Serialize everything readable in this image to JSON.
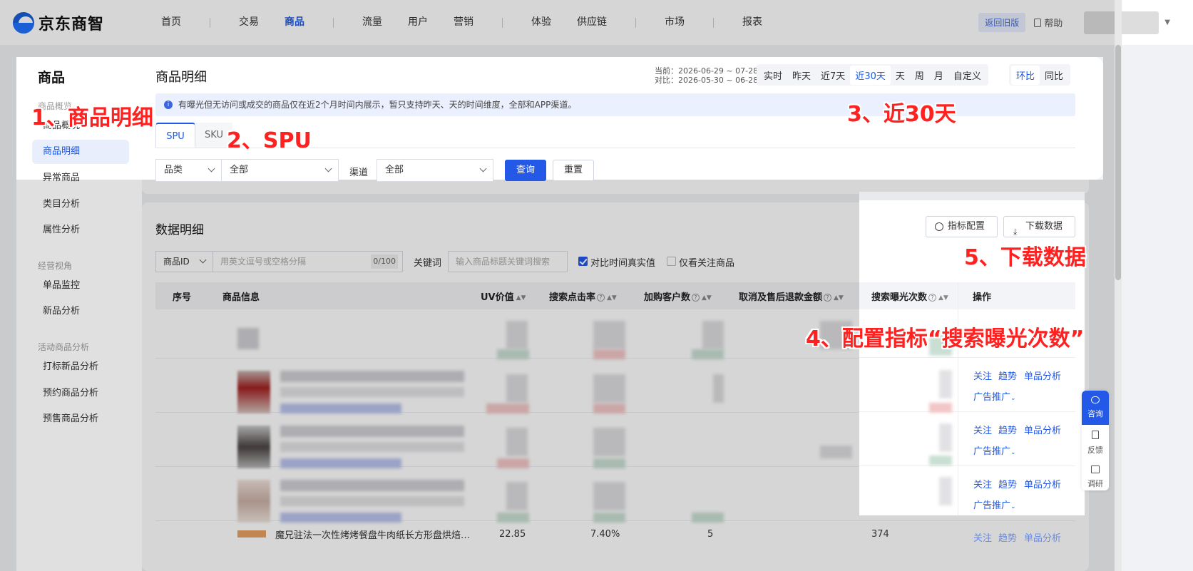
{
  "brand": {
    "name": "京东商智"
  },
  "nav": {
    "items": [
      "首页",
      "交易",
      "商品",
      "流量",
      "用户",
      "营销",
      "体验",
      "供应链",
      "市场",
      "报表"
    ],
    "active": "商品"
  },
  "top_right": {
    "old_version": "返回旧版",
    "help": "帮助"
  },
  "sidebar": {
    "title": "商品",
    "group1": "商品概览",
    "item_overview": "商品概况",
    "item_detail": "商品明细",
    "item_abnormal": "异常商品",
    "item_category": "类目分析",
    "item_attr": "属性分析",
    "group2": "经营视角",
    "item_single": "单品监控",
    "item_new": "新品分析",
    "group3": "活动商品分析",
    "item_tag_new": "打标新品分析",
    "item_presale_order": "预约商品分析",
    "item_presale": "预售商品分析"
  },
  "header": {
    "title": "商品明细",
    "current_range": "当前：2026-06-29 ~ 07-28",
    "compare_range": "对比：2026-05-30 ~ 06-28",
    "time_tabs": [
      "实时",
      "昨天",
      "近7天",
      "近30天",
      "天",
      "周",
      "月",
      "自定义"
    ],
    "time_active": "近30天",
    "compare_tabs": [
      "环比",
      "同比"
    ],
    "compare_active": "环比"
  },
  "notice": "有曝光但无访问或成交的商品仅在近2个月时间内展示，暂只支持昨天、天的时间维度，全部和APP渠道。",
  "tabs": {
    "spu": "SPU",
    "sku": "SKU"
  },
  "filters": {
    "category_label": "品类",
    "category_value": "全部",
    "channel_label": "渠道",
    "channel_value": "全部",
    "query": "查询",
    "reset": "重置"
  },
  "data_section": {
    "title": "数据明细",
    "id_select": "商品ID",
    "id_placeholder": "用英文逗号或空格分隔",
    "id_count": "0/100",
    "keyword_label": "关键词",
    "keyword_placeholder": "输入商品标题关键词搜索",
    "check_compare": "对比时间真实值",
    "check_compare_checked": true,
    "check_follow": "仅看关注商品",
    "check_follow_checked": false,
    "metric_config": "指标配置",
    "download": "下载数据"
  },
  "table": {
    "headers": [
      "序号",
      "商品信息",
      "UV价值",
      "搜索点击率",
      "加购客户数",
      "取消及售后退款金额",
      "搜索曝光次数",
      "操作"
    ],
    "row_actions": [
      "关注",
      "趋势",
      "单品分析"
    ],
    "ad_action": "广告推广",
    "bottom_row": {
      "title": "魔兄驻法一次性烤烤餐盘牛肉纸长方形盘烘焙…",
      "uv": "22.85",
      "ctr": "7.40%",
      "cart": "5",
      "exposure": "374"
    }
  },
  "annotations": {
    "a1": "1、商品明细",
    "a2": "2、SPU",
    "a3": "3、近30天",
    "a4": "4、配置指标“搜索曝光次数”",
    "a5": "5、下载数据"
  },
  "float_panel": {
    "consult": "咨询",
    "feedback": "反馈",
    "survey": "调研"
  },
  "colors": {
    "accent": "#2458e6",
    "annotation": "#ff2020"
  }
}
